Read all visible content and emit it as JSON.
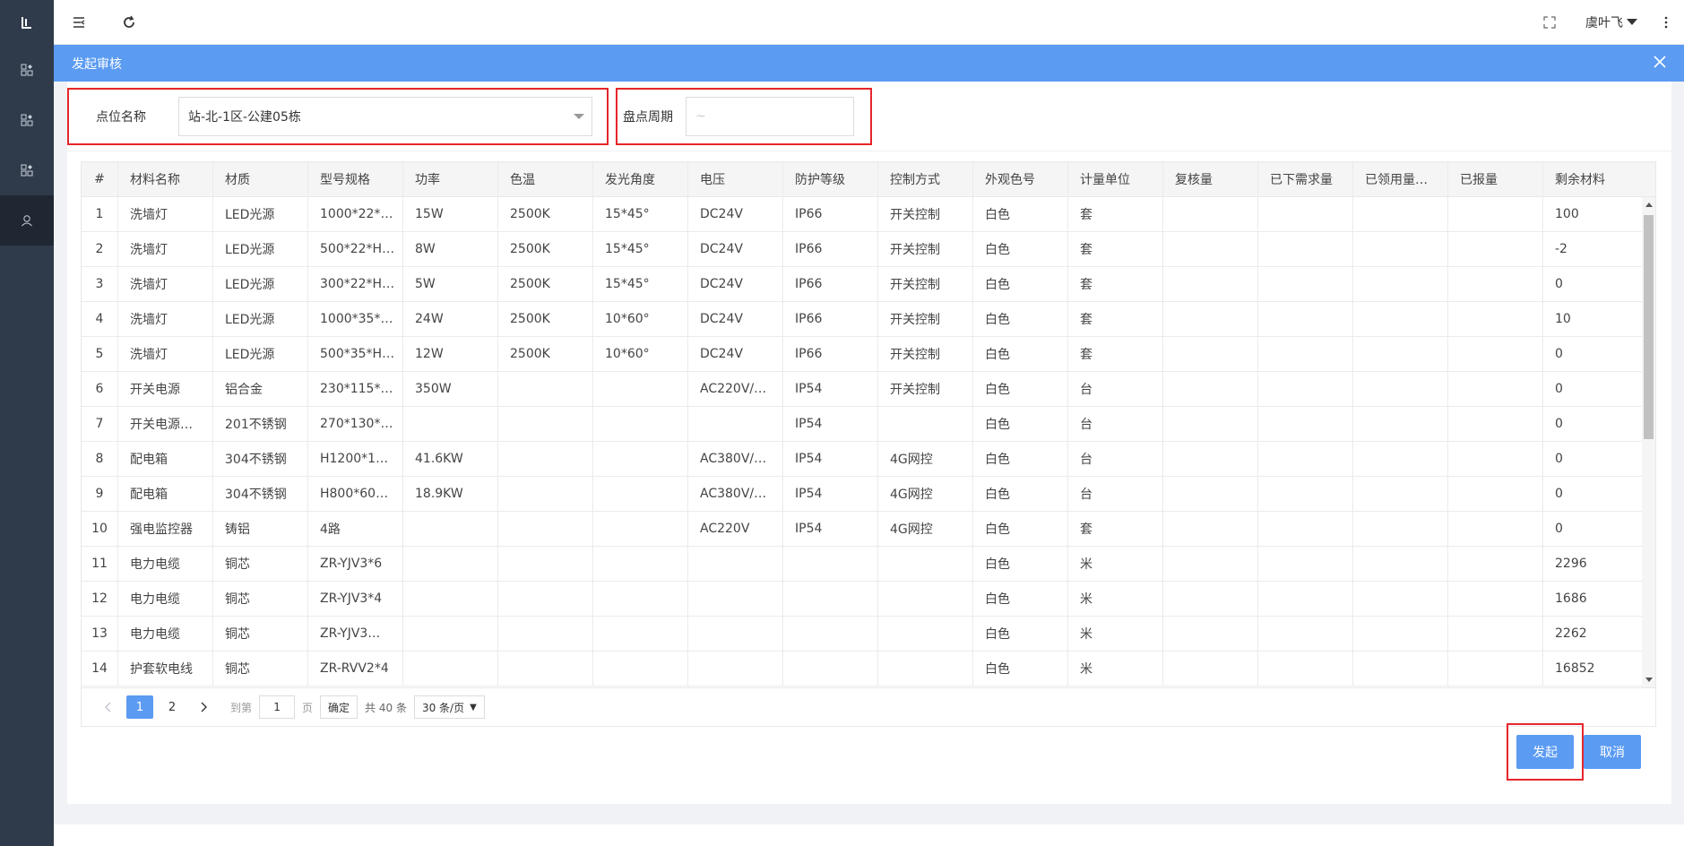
{
  "sidebar": {
    "logo_text": "L",
    "items": [
      "apps-icon",
      "apps-icon",
      "apps-icon",
      "user-icon"
    ]
  },
  "topbar": {
    "user_name": "虞叶飞"
  },
  "dialog": {
    "title": "发起审核"
  },
  "filters": {
    "location_label": "点位名称",
    "location_value": "站-北-1区-公建05栋",
    "period_label": "盘点周期",
    "period_placeholder": "~"
  },
  "table": {
    "headers": [
      "#",
      "材料名称",
      "材质",
      "型号规格",
      "功率",
      "色温",
      "发光角度",
      "电压",
      "防护等级",
      "控制方式",
      "外观色号",
      "计量单位",
      "复核量",
      "已下需求量",
      "已领用量…",
      "已报量",
      "剩余材料"
    ],
    "rows": [
      [
        "1",
        "洗墙灯",
        "LED光源",
        "1000*22*…",
        "15W",
        "2500K",
        "15*45°",
        "DC24V",
        "IP66",
        "开关控制",
        "白色",
        "套",
        "",
        "",
        "",
        "",
        "100"
      ],
      [
        "2",
        "洗墙灯",
        "LED光源",
        "500*22*H…",
        "8W",
        "2500K",
        "15*45°",
        "DC24V",
        "IP66",
        "开关控制",
        "白色",
        "套",
        "",
        "",
        "",
        "",
        "-2"
      ],
      [
        "3",
        "洗墙灯",
        "LED光源",
        "300*22*H…",
        "5W",
        "2500K",
        "15*45°",
        "DC24V",
        "IP66",
        "开关控制",
        "白色",
        "套",
        "",
        "",
        "",
        "",
        "0"
      ],
      [
        "4",
        "洗墙灯",
        "LED光源",
        "1000*35*…",
        "24W",
        "2500K",
        "10*60°",
        "DC24V",
        "IP66",
        "开关控制",
        "白色",
        "套",
        "",
        "",
        "",
        "",
        "10"
      ],
      [
        "5",
        "洗墙灯",
        "LED光源",
        "500*35*H…",
        "12W",
        "2500K",
        "10*60°",
        "DC24V",
        "IP66",
        "开关控制",
        "白色",
        "套",
        "",
        "",
        "",
        "",
        "0"
      ],
      [
        "6",
        "开关电源",
        "铝合金",
        "230*115*…",
        "350W",
        "",
        "",
        "AC220V/…",
        "IP54",
        "开关控制",
        "白色",
        "台",
        "",
        "",
        "",
        "",
        "0"
      ],
      [
        "7",
        "开关电源…",
        "201不锈钢",
        "270*130*…",
        "",
        "",
        "",
        "",
        "IP54",
        "",
        "白色",
        "台",
        "",
        "",
        "",
        "",
        "0"
      ],
      [
        "8",
        "配电箱",
        "304不锈钢",
        "H1200*1…",
        "41.6KW",
        "",
        "",
        "AC380V/…",
        "IP54",
        "4G网控",
        "白色",
        "台",
        "",
        "",
        "",
        "",
        "0"
      ],
      [
        "9",
        "配电箱",
        "304不锈钢",
        "H800*60…",
        "18.9KW",
        "",
        "",
        "AC380V/…",
        "IP54",
        "4G网控",
        "白色",
        "台",
        "",
        "",
        "",
        "",
        "0"
      ],
      [
        "10",
        "强电监控器",
        "铸铝",
        "4路",
        "",
        "",
        "",
        "AC220V",
        "IP54",
        "4G网控",
        "白色",
        "套",
        "",
        "",
        "",
        "",
        "0"
      ],
      [
        "11",
        "电力电缆",
        "铜芯",
        "ZR-YJV3*6",
        "",
        "",
        "",
        "",
        "",
        "",
        "白色",
        "米",
        "",
        "",
        "",
        "",
        "2296"
      ],
      [
        "12",
        "电力电缆",
        "铜芯",
        "ZR-YJV3*4",
        "",
        "",
        "",
        "",
        "",
        "",
        "白色",
        "米",
        "",
        "",
        "",
        "",
        "1686"
      ],
      [
        "13",
        "电力电缆",
        "铜芯",
        "ZR-YJV3…",
        "",
        "",
        "",
        "",
        "",
        "",
        "白色",
        "米",
        "",
        "",
        "",
        "",
        "2262"
      ],
      [
        "14",
        "护套软电线",
        "铜芯",
        "ZR-RVV2*4",
        "",
        "",
        "",
        "",
        "",
        "",
        "白色",
        "米",
        "",
        "",
        "",
        "",
        "16852"
      ]
    ]
  },
  "pager": {
    "pages": [
      "1",
      "2"
    ],
    "goto_label": "到第",
    "goto_value": "1",
    "page_label": "页",
    "confirm_label": "确定",
    "total_label": "共 40 条",
    "page_size_label": "30 条/页"
  },
  "actions": {
    "submit_label": "发起",
    "cancel_label": "取消"
  },
  "colors": {
    "primary": "#5b9bf2",
    "sidebar": "#2f3a4a",
    "highlight": "#e5262b"
  }
}
